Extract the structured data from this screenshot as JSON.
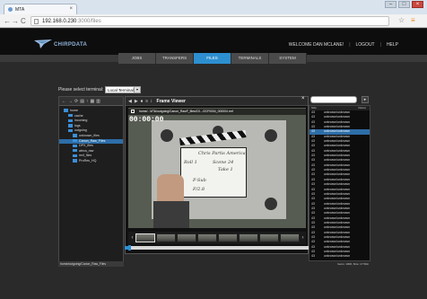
{
  "browser": {
    "tab_title": "MTA",
    "tab_close": "×",
    "url_host": "192.168.0.230",
    "url_path": ":3000/files",
    "back": "←",
    "forward": "→",
    "reload": "C",
    "star": "☆",
    "menu": "≡",
    "minimize": "–",
    "maximize": "□",
    "close": "×"
  },
  "header": {
    "logo_text": "CHIRPDATA",
    "welcome": "WELCOME DAN MCLANE!",
    "logout": "LOGOUT",
    "help": "HELP",
    "sep": "|"
  },
  "nav": {
    "tabs": [
      "JOBS",
      "TRANSFERS",
      "FILES",
      "TERMINALS",
      "SYSTEM"
    ],
    "active": "FILES"
  },
  "terminal_select": {
    "label": "Please select terminal:",
    "value": "Local Terminal"
  },
  "file_tree": {
    "toolbar_icons": [
      "←",
      "→",
      "⟳",
      "▤",
      "↑",
      "▦",
      "▥"
    ],
    "items": [
      {
        "label": "home",
        "level": 0,
        "selected": false
      },
      {
        "label": "cache",
        "level": 1,
        "selected": false
      },
      {
        "label": "incoming",
        "level": 1,
        "selected": false
      },
      {
        "label": "logs",
        "level": 1,
        "selected": false
      },
      {
        "label": "outgoing",
        "level": 1,
        "selected": false
      },
      {
        "label": "unknown_files",
        "level": 2,
        "selected": false
      },
      {
        "label": "Canon_Raw_Files",
        "level": 2,
        "selected": true
      },
      {
        "label": "DPX_files",
        "level": 2,
        "selected": false
      },
      {
        "label": "alexa_raw",
        "level": 2,
        "selected": false
      },
      {
        "label": "mxf_files",
        "level": 2,
        "selected": false
      },
      {
        "label": "ProRes_HQ",
        "level": 2,
        "selected": false
      }
    ],
    "footer_path": "home/outgoing/Canon_Raw_Files"
  },
  "viewer": {
    "toolbar_icons": [
      "◀",
      "▶",
      "⏹",
      "≡",
      "ⅰ"
    ],
    "title": "Frame Viewer",
    "close": "×",
    "clip_path": "home/...MTA/outgoing/Canon_RawF_files/C0.../2CF0004_000004.rmf",
    "timecode": "00:00:00",
    "slate_lines": [
      "Chris Partis America",
      "Roll 1",
      "Scene 24",
      "Take 1",
      "F-Sub",
      "F/2.8"
    ],
    "filmstrip_prev": "‹",
    "filmstrip_next": "›",
    "filmstrip_count": 8,
    "scrub_position": 0.02
  },
  "file_list": {
    "columns": [
      "Size",
      "Owner"
    ],
    "rows": [
      {
        "id": "43",
        "owner": "unknown/unknown",
        "selected": false
      },
      {
        "id": "43",
        "owner": "unknown/unknown",
        "selected": false
      },
      {
        "id": "43",
        "owner": "unknown/unknown",
        "selected": false
      },
      {
        "id": "43",
        "owner": "unknown/unknown",
        "selected": false
      },
      {
        "id": "43",
        "owner": "unknown/unknown",
        "selected": true
      },
      {
        "id": "43",
        "owner": "unknown/unknown",
        "selected": false
      },
      {
        "id": "43",
        "owner": "unknown/unknown",
        "selected": false
      },
      {
        "id": "43",
        "owner": "unknown/unknown",
        "selected": false
      },
      {
        "id": "43",
        "owner": "unknown/unknown",
        "selected": false
      },
      {
        "id": "43",
        "owner": "unknown/unknown",
        "selected": false
      },
      {
        "id": "43",
        "owner": "unknown/unknown",
        "selected": false
      },
      {
        "id": "43",
        "owner": "unknown/unknown",
        "selected": false
      },
      {
        "id": "43",
        "owner": "unknown/unknown",
        "selected": false
      },
      {
        "id": "43",
        "owner": "unknown/unknown",
        "selected": false
      },
      {
        "id": "43",
        "owner": "unknown/unknown",
        "selected": false
      },
      {
        "id": "43",
        "owner": "unknown/unknown",
        "selected": false
      },
      {
        "id": "43",
        "owner": "unknown/unknown",
        "selected": false
      },
      {
        "id": "43",
        "owner": "unknown/unknown",
        "selected": false
      },
      {
        "id": "43",
        "owner": "unknown/unknown",
        "selected": false
      },
      {
        "id": "43",
        "owner": "unknown/unknown",
        "selected": false
      },
      {
        "id": "43",
        "owner": "unknown/unknown",
        "selected": false
      },
      {
        "id": "43",
        "owner": "unknown/unknown",
        "selected": false
      },
      {
        "id": "43",
        "owner": "unknown/unknown",
        "selected": false
      },
      {
        "id": "43",
        "owner": "unknown/unknown",
        "selected": false
      },
      {
        "id": "43",
        "owner": "unknown/unknown",
        "selected": false
      },
      {
        "id": "43",
        "owner": "unknown/unknown",
        "selected": false
      },
      {
        "id": "43",
        "owner": "unknown/unknown",
        "selected": false
      },
      {
        "id": "43",
        "owner": "unknown/unknown",
        "selected": false
      },
      {
        "id": "43",
        "owner": "unknown/unknown",
        "selected": false
      },
      {
        "id": "43",
        "owner": "unknown/unknown",
        "selected": false
      },
      {
        "id": "43",
        "owner": "unknown/unknown",
        "selected": false
      }
    ],
    "footer": "Items: 1000, Size: 17.5Gb",
    "search_button": "▸"
  },
  "colors": {
    "accent": "#2d8fd0",
    "selection": "#2d6ea8",
    "background": "#2a2a2a"
  }
}
